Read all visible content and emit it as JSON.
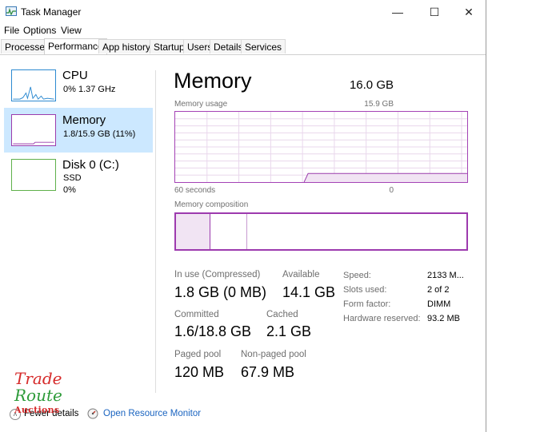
{
  "window": {
    "title": "Task Manager"
  },
  "titlebar": {
    "minimize": "—",
    "maximize": "☐",
    "close": "✕"
  },
  "menu": [
    "File",
    "Options",
    "View"
  ],
  "tabs": [
    "Processes",
    "Performance",
    "App history",
    "Startup",
    "Users",
    "Details",
    "Services"
  ],
  "active_tab": "Performance",
  "sidebar": {
    "items": [
      {
        "title": "CPU",
        "sub1": "0%  1.37 GHz",
        "sub2": ""
      },
      {
        "title": "Memory",
        "sub1": "1.8/15.9 GB (11%)",
        "sub2": ""
      },
      {
        "title": "Disk 0 (C:)",
        "sub1": "SSD",
        "sub2": "0%"
      }
    ],
    "selected": "Memory"
  },
  "main": {
    "title": "Memory",
    "total": "16.0 GB",
    "usage_label": "Memory usage",
    "usage_max": "15.9 GB",
    "time_left": "60 seconds",
    "time_right": "0",
    "composition_label": "Memory composition",
    "stats": {
      "in_use_label": "In use (Compressed)",
      "in_use": "1.8 GB (0 MB)",
      "available_label": "Available",
      "available": "14.1 GB",
      "committed_label": "Committed",
      "committed": "1.6/18.8 GB",
      "cached_label": "Cached",
      "cached": "2.1 GB",
      "paged_label": "Paged pool",
      "paged": "120 MB",
      "nonpaged_label": "Non-paged pool",
      "nonpaged": "67.9 MB"
    },
    "specs": {
      "speed_label": "Speed:",
      "speed": "2133 M...",
      "slots_label": "Slots used:",
      "slots": "2 of 2",
      "form_label": "Form factor:",
      "form": "DIMM",
      "reserved_label": "Hardware reserved:",
      "reserved": "93.2 MB"
    }
  },
  "bottom": {
    "fewer_details": "Fewer details",
    "open_monitor": "Open Resource Monitor"
  },
  "watermark": {
    "line1": "Trade",
    "line2": "Route",
    "line3": "Auctions"
  },
  "colors": {
    "memory": "#9b3cad",
    "cpu": "#2d8ad1",
    "disk": "#5fb04a",
    "selected": "#cce8ff",
    "link": "#1a64c0"
  }
}
